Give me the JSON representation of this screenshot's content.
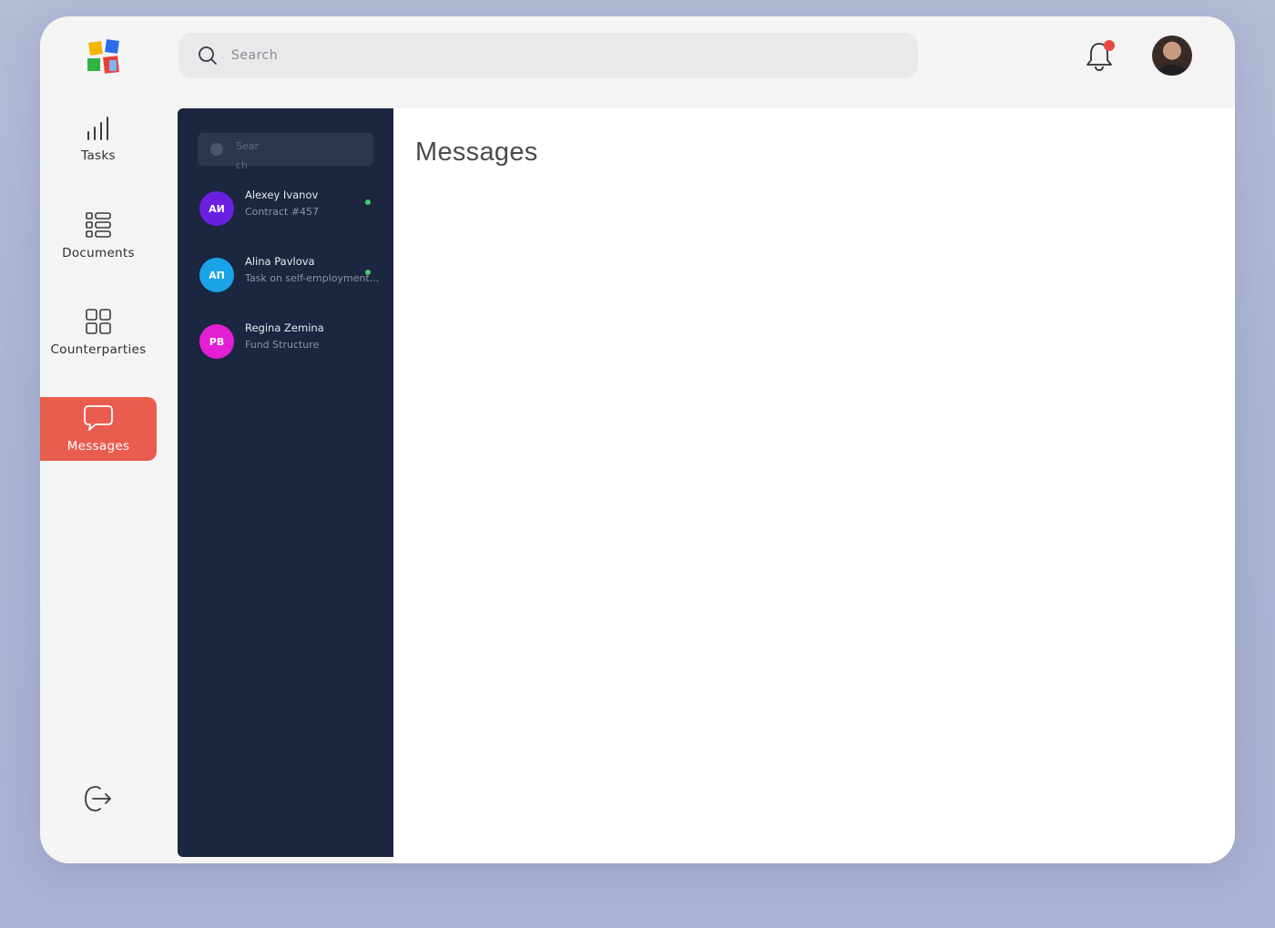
{
  "header": {
    "search_placeholder": "Search"
  },
  "sidebar": {
    "items": [
      {
        "label": "Tasks",
        "icon": "bar-chart-icon"
      },
      {
        "label": "Documents",
        "icon": "list-icon"
      },
      {
        "label": "Counterparties",
        "icon": "grid-icon"
      },
      {
        "label": "Messages",
        "icon": "chat-bubble-icon",
        "active": true
      }
    ],
    "logout_icon": "logout-icon"
  },
  "chat_list": {
    "search_placeholder": "Search",
    "contacts": [
      {
        "initials": "АИ",
        "name": "Alexey Ivanov",
        "subtitle": "Contract #457",
        "online": true,
        "color": "#6a1fe0"
      },
      {
        "initials": "АП",
        "name": "Alina Pavlova",
        "subtitle": "Task on self-employment...",
        "online": true,
        "color": "#1aa3e8"
      },
      {
        "initials": "РВ",
        "name": "Regina Zemina",
        "subtitle": "Fund Structure",
        "online": false,
        "color": "#e21fd4"
      }
    ]
  },
  "main": {
    "title": "Messages"
  },
  "colors": {
    "accent": "#e95c4f",
    "panel": "#1b2640",
    "online": "#3fd06b",
    "notification": "#e8473f"
  }
}
